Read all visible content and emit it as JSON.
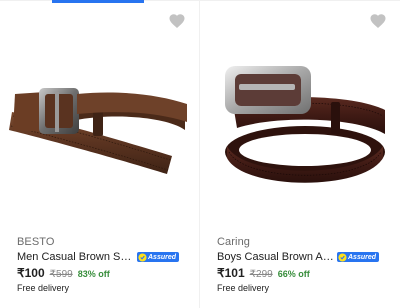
{
  "products": [
    {
      "brand": "BESTO",
      "title": "Men Casual Brown Syntheti...",
      "assured_label": "Assured",
      "price": "₹100",
      "mrp": "₹599",
      "discount": "83% off",
      "delivery": "Free delivery",
      "image": "brown-belt-gunmetal-buckle",
      "wishlist_icon": "heart-icon"
    },
    {
      "brand": "Caring",
      "title": "Boys Casual Brown Artificia...",
      "assured_label": "Assured",
      "price": "₹101",
      "mrp": "₹299",
      "discount": "66% off",
      "delivery": "Free delivery",
      "image": "dark-brown-belt-silver-buckle",
      "wishlist_icon": "heart-icon"
    }
  ],
  "colors": {
    "accent": "#2874f0",
    "discount": "#388e3c",
    "heart": "#c2c2c2"
  }
}
